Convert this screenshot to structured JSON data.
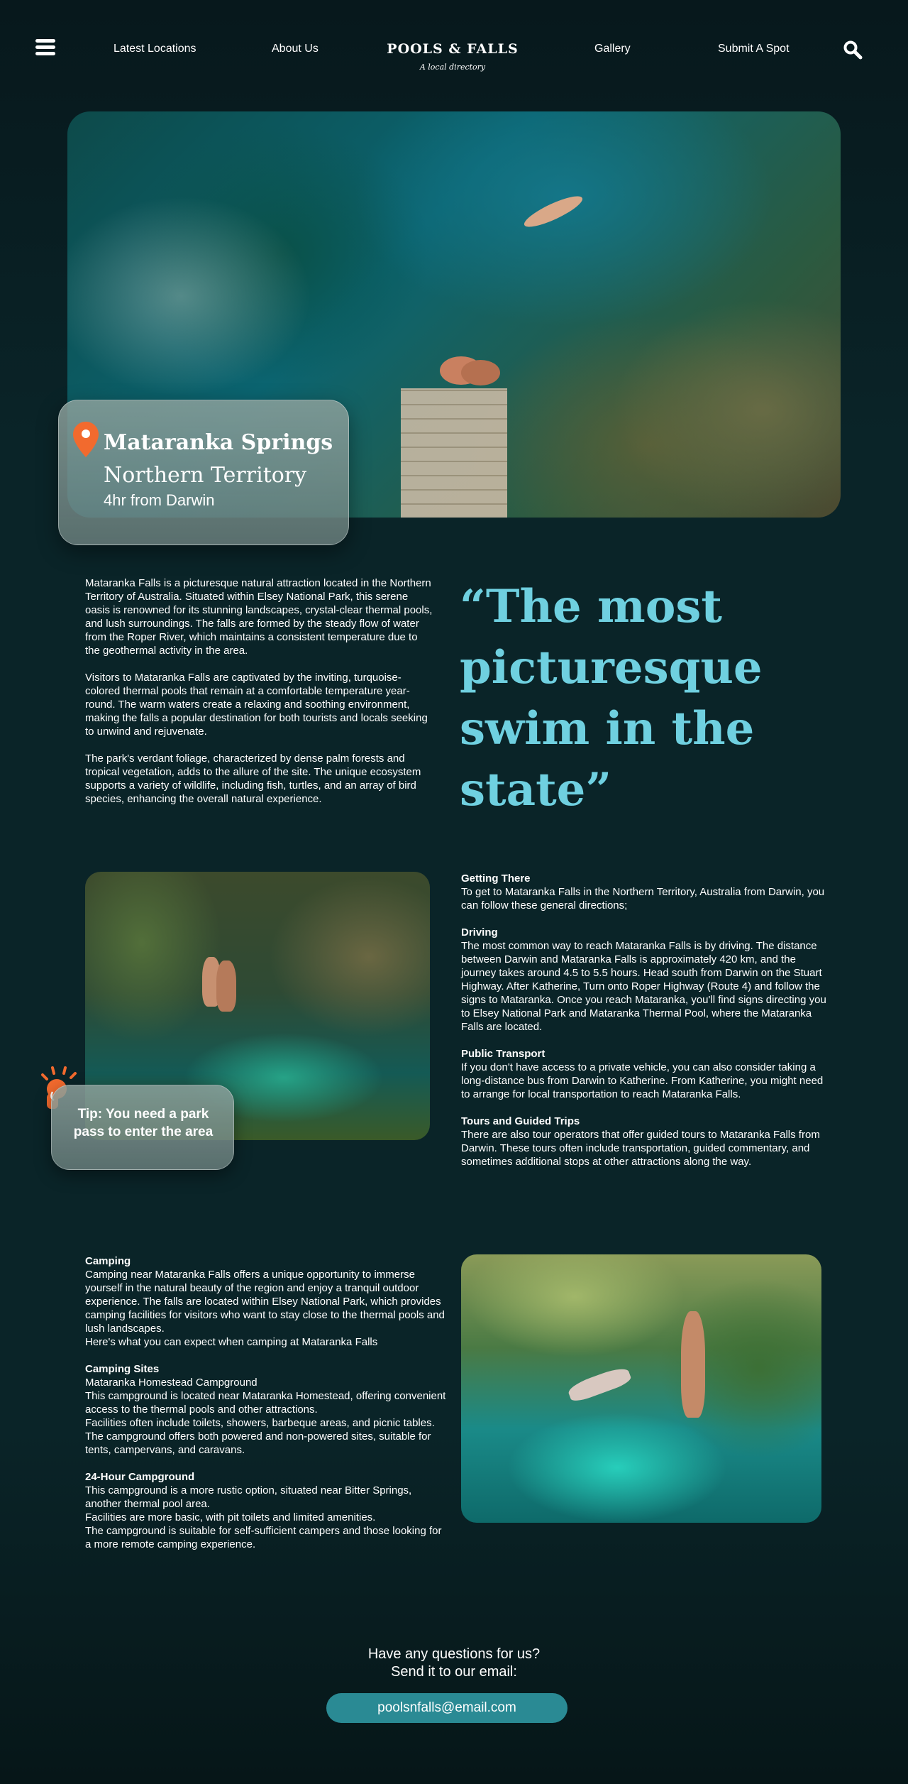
{
  "nav": {
    "links": [
      "Latest Locations",
      "About Us",
      "Gallery",
      "Submit A Spot"
    ],
    "brand_title": "POOLS & FALLS",
    "brand_subtitle": "A local directory"
  },
  "location": {
    "name": "Mataranka Springs",
    "region": "Northern Territory",
    "distance": "4hr from Darwin"
  },
  "intro": [
    "Mataranka Falls is a picturesque natural attraction located in the Northern Territory of Australia. Situated within Elsey National Park, this serene oasis is renowned for its stunning landscapes, crystal-clear thermal pools, and lush surroundings. The falls are formed by the steady flow of water from the Roper River, which maintains a consistent temperature due to the geothermal activity in the area.",
    "Visitors to Mataranka Falls are captivated by the inviting, turquoise-colored thermal pools that remain at a comfortable temperature year-round. The warm waters create a relaxing and soothing environment, making the falls a popular destination for both tourists and locals seeking to unwind and rejuvenate.",
    "The park's verdant foliage, characterized by dense palm forests and tropical vegetation, adds to the allure of the site. The unique ecosystem supports a variety of wildlife, including fish, turtles, and an array of bird species, enhancing the overall natural experience."
  ],
  "quote": "“The most picturesque swim in the state”",
  "tip": "Tip: You need a park pass to enter the area",
  "getting_there": {
    "title": "Getting There",
    "intro": "To get to Mataranka Falls in the Northern Territory, Australia from Darwin, you can follow these general directions;",
    "driving_title": "Driving",
    "driving_text": "The most common way to reach Mataranka Falls is by driving. The distance between Darwin and Mataranka Falls is approximately 420 km, and the journey takes around 4.5 to 5.5 hours. Head south from Darwin on the Stuart Highway. After Katherine, Turn onto Roper Highway (Route 4) and follow the signs to Mataranka. Once you reach Mataranka, you'll find signs directing you to Elsey National Park and Mataranka Thermal Pool, where the Mataranka Falls are located.",
    "transport_title": "Public Transport",
    "transport_text": "If you don't have access to a private vehicle, you can also consider taking a long-distance bus from Darwin to Katherine. From Katherine, you might need to arrange for local transportation to reach Mataranka Falls.",
    "tours_title": "Tours and Guided Trips",
    "tours_text": "There are also tour operators that offer guided tours to Mataranka Falls from Darwin. These tours often include transportation, guided commentary, and sometimes additional stops at other attractions along the way."
  },
  "camping": {
    "title": "Camping",
    "intro": "Camping near Mataranka Falls  offers a unique opportunity to immerse yourself in the natural beauty of the region and enjoy a tranquil outdoor experience. The falls are located within Elsey National Park, which provides camping facilities for visitors who want to stay close to the thermal pools and lush landscapes.",
    "intro2": "Here's what you can expect when camping at Mataranka Falls",
    "sites_title": "Camping Sites",
    "sites_lines": [
      "Mataranka Homestead Campground",
      "This campground is located near Mataranka Homestead, offering convenient access to the thermal pools and other attractions.",
      "Facilities often include toilets, showers, barbeque areas, and picnic tables.",
      "The campground offers both powered and non-powered sites, suitable for tents, campervans, and caravans."
    ],
    "h24_title": "24-Hour Campground",
    "h24_lines": [
      "This campground is a more rustic option, situated near Bitter Springs, another thermal pool area.",
      "Facilities are more basic, with pit toilets and limited amenities.",
      "The campground is suitable for self-sufficient campers and those looking for a more remote camping experience."
    ]
  },
  "contact": {
    "line1": "Have any questions for us?",
    "line2": "Send it to our email:",
    "email": "poolsnfalls@email.com"
  },
  "colors": {
    "background": "#0a2428",
    "accent_quote": "#6fd0e0",
    "pin": "#f26a2e",
    "button": "#2a8a94"
  },
  "icons": [
    "menu-icon",
    "search-icon",
    "map-pin-icon",
    "lightbulb-icon"
  ]
}
